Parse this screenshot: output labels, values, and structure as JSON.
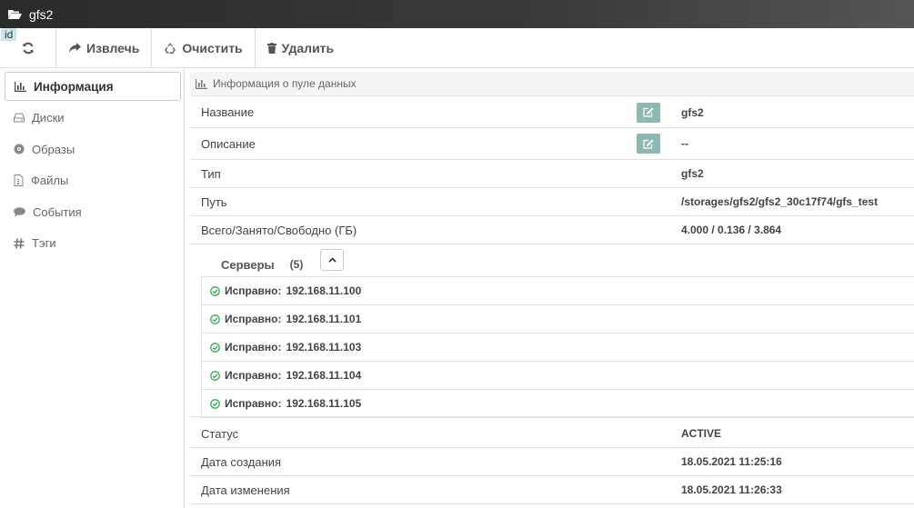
{
  "window": {
    "title": "gfs2"
  },
  "id_badge": "id",
  "toolbar": {
    "extract_label": "Извлечь",
    "clear_label": "Очистить",
    "delete_label": "Удалить"
  },
  "sidebar": {
    "items": [
      {
        "label": "Информация",
        "icon": "bar-chart-icon",
        "active": true
      },
      {
        "label": "Диски",
        "icon": "hdd-icon"
      },
      {
        "label": "Образы",
        "icon": "disc-icon"
      },
      {
        "label": "Файлы",
        "icon": "file-icon"
      },
      {
        "label": "События",
        "icon": "comment-icon"
      },
      {
        "label": "Тэги",
        "icon": "hashtag-icon"
      }
    ]
  },
  "panel": {
    "title": "Информация о пуле данных",
    "fields": {
      "name": {
        "label": "Название",
        "value": "gfs2"
      },
      "description": {
        "label": "Описание",
        "value": "--"
      },
      "type": {
        "label": "Тип",
        "value": "gfs2"
      },
      "path": {
        "label": "Путь",
        "value": "/storages/gfs2/gfs2_30c17f74/gfs_test"
      },
      "size": {
        "label": "Всего/Занято/Свободно (ГБ)",
        "value": "4.000 / 0.136 / 3.864"
      },
      "status": {
        "label": "Статус",
        "value": "ACTIVE"
      },
      "created": {
        "label": "Дата создания",
        "value": "18.05.2021 11:25:16"
      },
      "modified": {
        "label": "Дата изменения",
        "value": "18.05.2021 11:26:33"
      }
    },
    "servers": {
      "label": "Серверы",
      "count": "(5)",
      "items": [
        {
          "status": "Исправно:",
          "ip": "192.168.11.100"
        },
        {
          "status": "Исправно:",
          "ip": "192.168.11.101"
        },
        {
          "status": "Исправно:",
          "ip": "192.168.11.103"
        },
        {
          "status": "Исправно:",
          "ip": "192.168.11.104"
        },
        {
          "status": "Исправно:",
          "ip": "192.168.11.105"
        }
      ]
    }
  },
  "colors": {
    "ok": "#3aa657",
    "edit_button": "#8fb9b0",
    "titlebar": "#2f2f2f"
  }
}
